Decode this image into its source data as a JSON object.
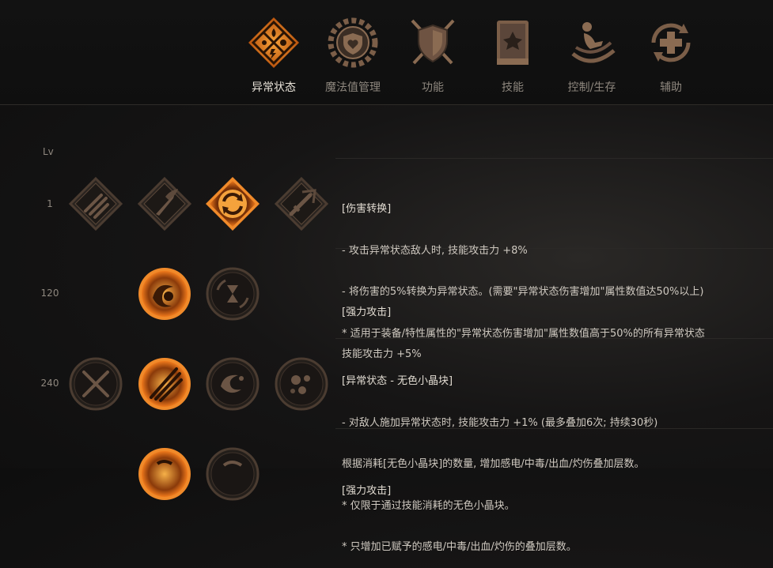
{
  "tabs": [
    {
      "label": "异常状态",
      "icon": "elemental-diamond-icon",
      "active": true
    },
    {
      "label": "魔法值管理",
      "icon": "shield-heart-gear-icon",
      "active": false
    },
    {
      "label": "功能",
      "icon": "crossed-swords-shield-icon",
      "active": false
    },
    {
      "label": "技能",
      "icon": "skill-book-icon",
      "active": false
    },
    {
      "label": "控制/生存",
      "icon": "rolling-figure-icon",
      "active": false
    },
    {
      "label": "辅助",
      "icon": "plus-cycle-icon",
      "active": false
    }
  ],
  "level_header": "Lv",
  "rows": [
    {
      "level": "1",
      "desc_title": "[伤害转换]",
      "desc_lines": [
        "- 攻击异常状态敌人时, 技能攻击力 +8%",
        "- 将伤害的5%转换为异常状态。(需要\"异常状态伤害增加\"属性数值达50%以上)",
        "* 适用于装备/特性属性的\"异常状态伤害增加\"属性数值高于50%的所有异常状态"
      ]
    },
    {
      "level": "120",
      "desc_title": "[强力攻击]",
      "desc_lines": [
        "技能攻击力 +5%"
      ]
    },
    {
      "level": "240",
      "desc_title": "[异常状态 - 无色小晶块]",
      "desc_lines": [
        "- 对敌人施加异常状态时, 技能攻击力 +1% (最多叠加6次; 持续30秒)",
        "根据消耗[无色小晶块]的数量, 增加感电/中毒/出血/灼伤叠加层数。",
        "* 仅限于通过技能消耗的无色小晶块。",
        "* 只增加已赋予的感电/中毒/出血/灼伤的叠加层数。"
      ]
    },
    {
      "level": "",
      "desc_title": "[强力攻击]",
      "desc_lines": []
    }
  ],
  "nodes": [
    {
      "name": "claw-slash-icon",
      "shape": "diamond",
      "state": "inactive"
    },
    {
      "name": "winged-dagger-icon",
      "shape": "diamond",
      "state": "inactive"
    },
    {
      "name": "cycle-arrows-icon",
      "shape": "diamond",
      "state": "active"
    },
    {
      "name": "sword-strike-icon",
      "shape": "diamond",
      "state": "inactive"
    },
    {
      "name": "fiery-swirl-icon",
      "shape": "circle",
      "state": "active"
    },
    {
      "name": "hourglass-swap-icon",
      "shape": "circle",
      "state": "inactive"
    },
    {
      "name": "crossed-blades-icon",
      "shape": "circle",
      "state": "inactive"
    },
    {
      "name": "triple-spear-icon",
      "shape": "circle",
      "state": "active"
    },
    {
      "name": "storm-swirl-icon",
      "shape": "circle",
      "state": "inactive"
    },
    {
      "name": "orb-cluster-icon",
      "shape": "circle",
      "state": "inactive"
    },
    {
      "name": "flame-orb-icon",
      "shape": "circle",
      "state": "active"
    },
    {
      "name": "arc-swirl-icon",
      "shape": "circle",
      "state": "inactive"
    }
  ]
}
